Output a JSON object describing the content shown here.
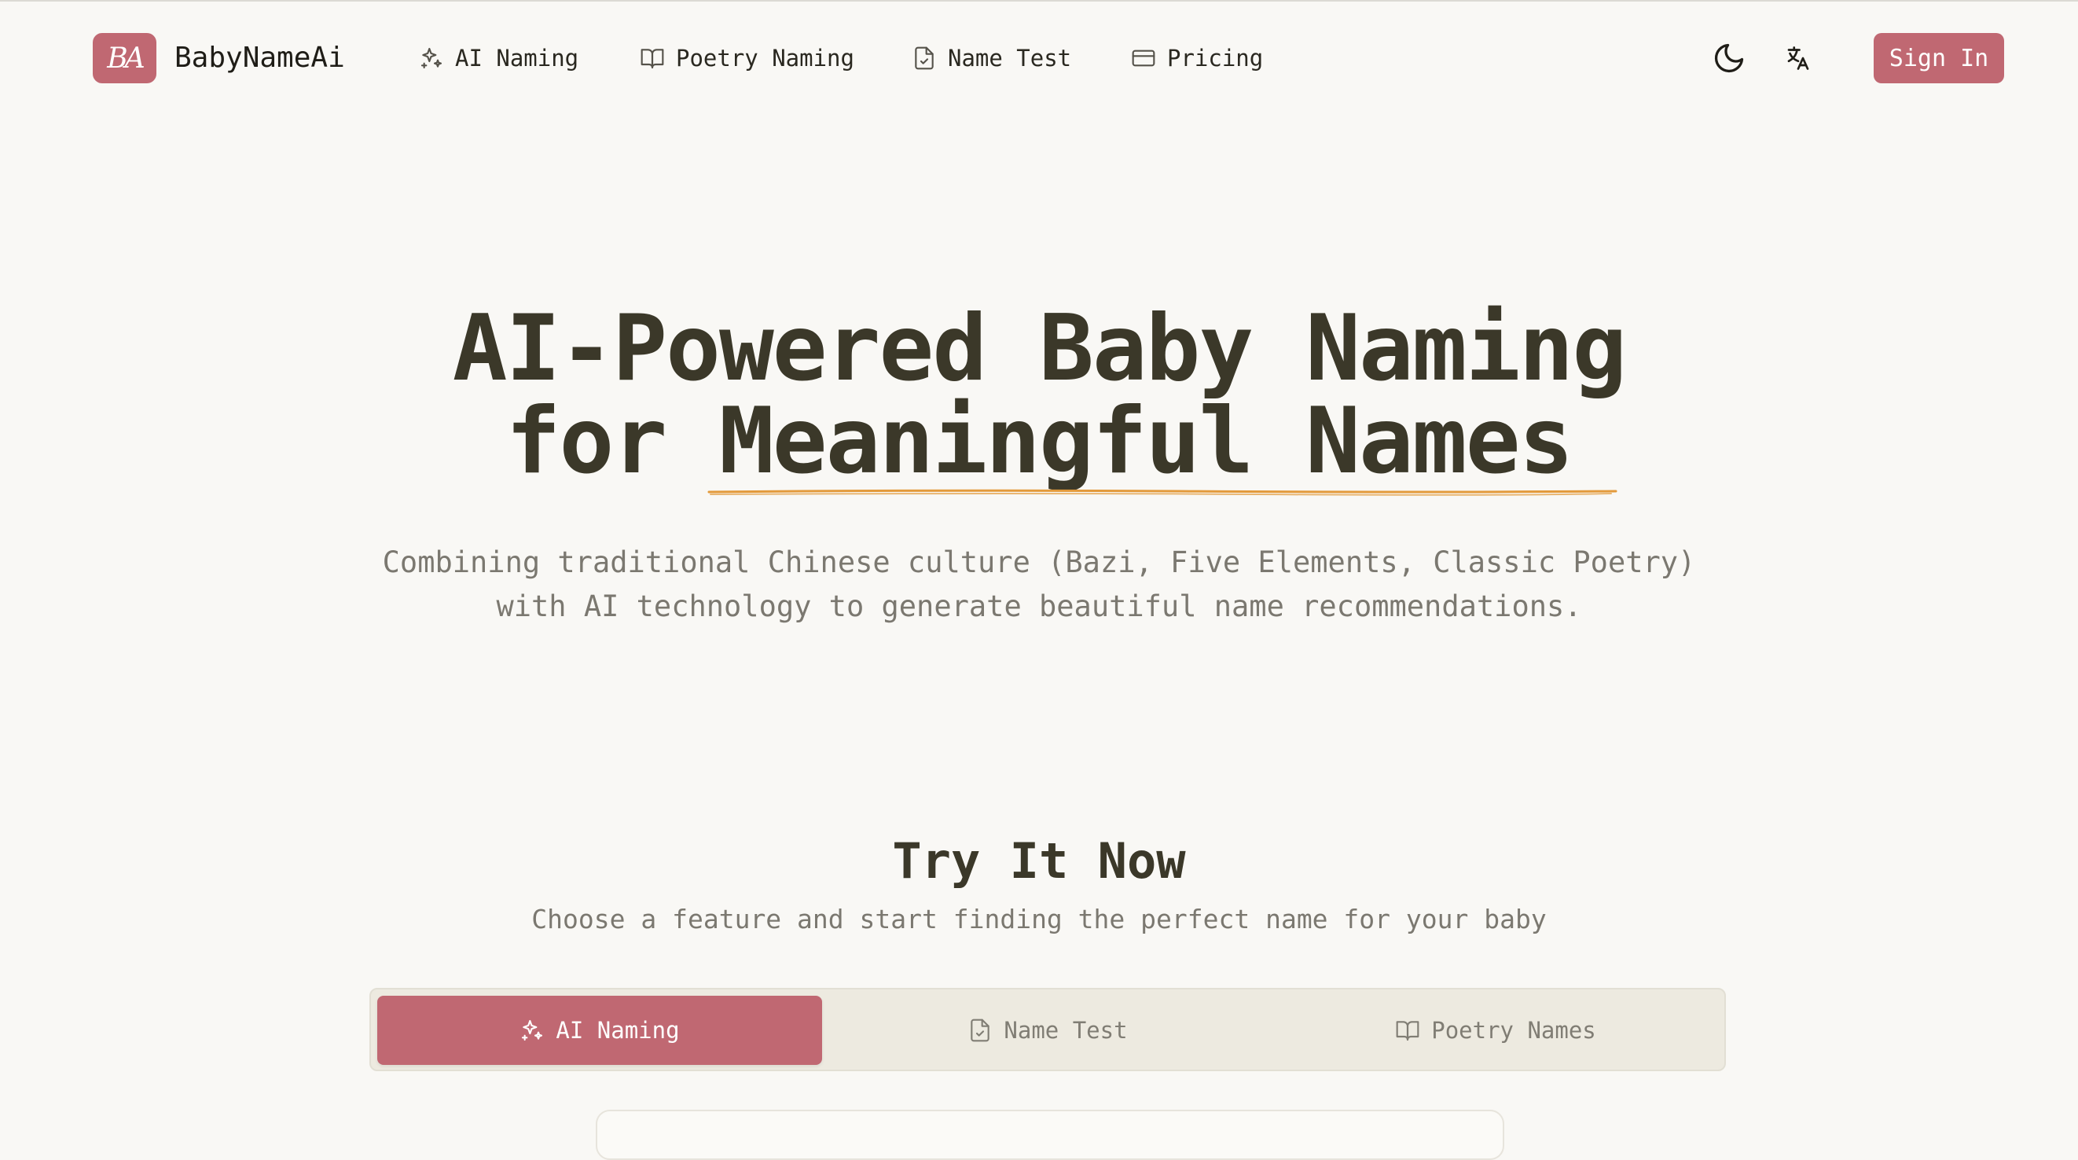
{
  "header": {
    "logo_text": "BA",
    "brand": "BabyNameAi",
    "nav": [
      {
        "label": "AI Naming",
        "icon": "sparkles-icon"
      },
      {
        "label": "Poetry Naming",
        "icon": "book-open-icon"
      },
      {
        "label": "Name Test",
        "icon": "file-check-icon"
      },
      {
        "label": "Pricing",
        "icon": "credit-card-icon"
      }
    ],
    "theme_icon": "moon-icon",
    "language_icon": "translate-icon",
    "sign_in_label": "Sign In"
  },
  "hero": {
    "title_line1": "AI-Powered Baby Naming",
    "title_line2": "for Meaningful Names",
    "subtitle_line1": "Combining traditional Chinese culture (Bazi, Five Elements, Classic Poetry)",
    "subtitle_line2": "with AI technology to generate beautiful name recommendations."
  },
  "try_section": {
    "title": "Try It Now",
    "subtitle": "Choose a feature and start finding the perfect name for your baby",
    "tabs": [
      {
        "label": "AI Naming",
        "icon": "sparkles-icon",
        "active": true
      },
      {
        "label": "Name Test",
        "icon": "file-check-icon",
        "active": false
      },
      {
        "label": "Poetry Names",
        "icon": "book-open-icon",
        "active": false
      }
    ]
  },
  "colors": {
    "accent": "#c06872",
    "background": "#f9f8f5",
    "heading": "#3b3829",
    "muted": "#7b7870",
    "underline": "#e39a3b"
  }
}
